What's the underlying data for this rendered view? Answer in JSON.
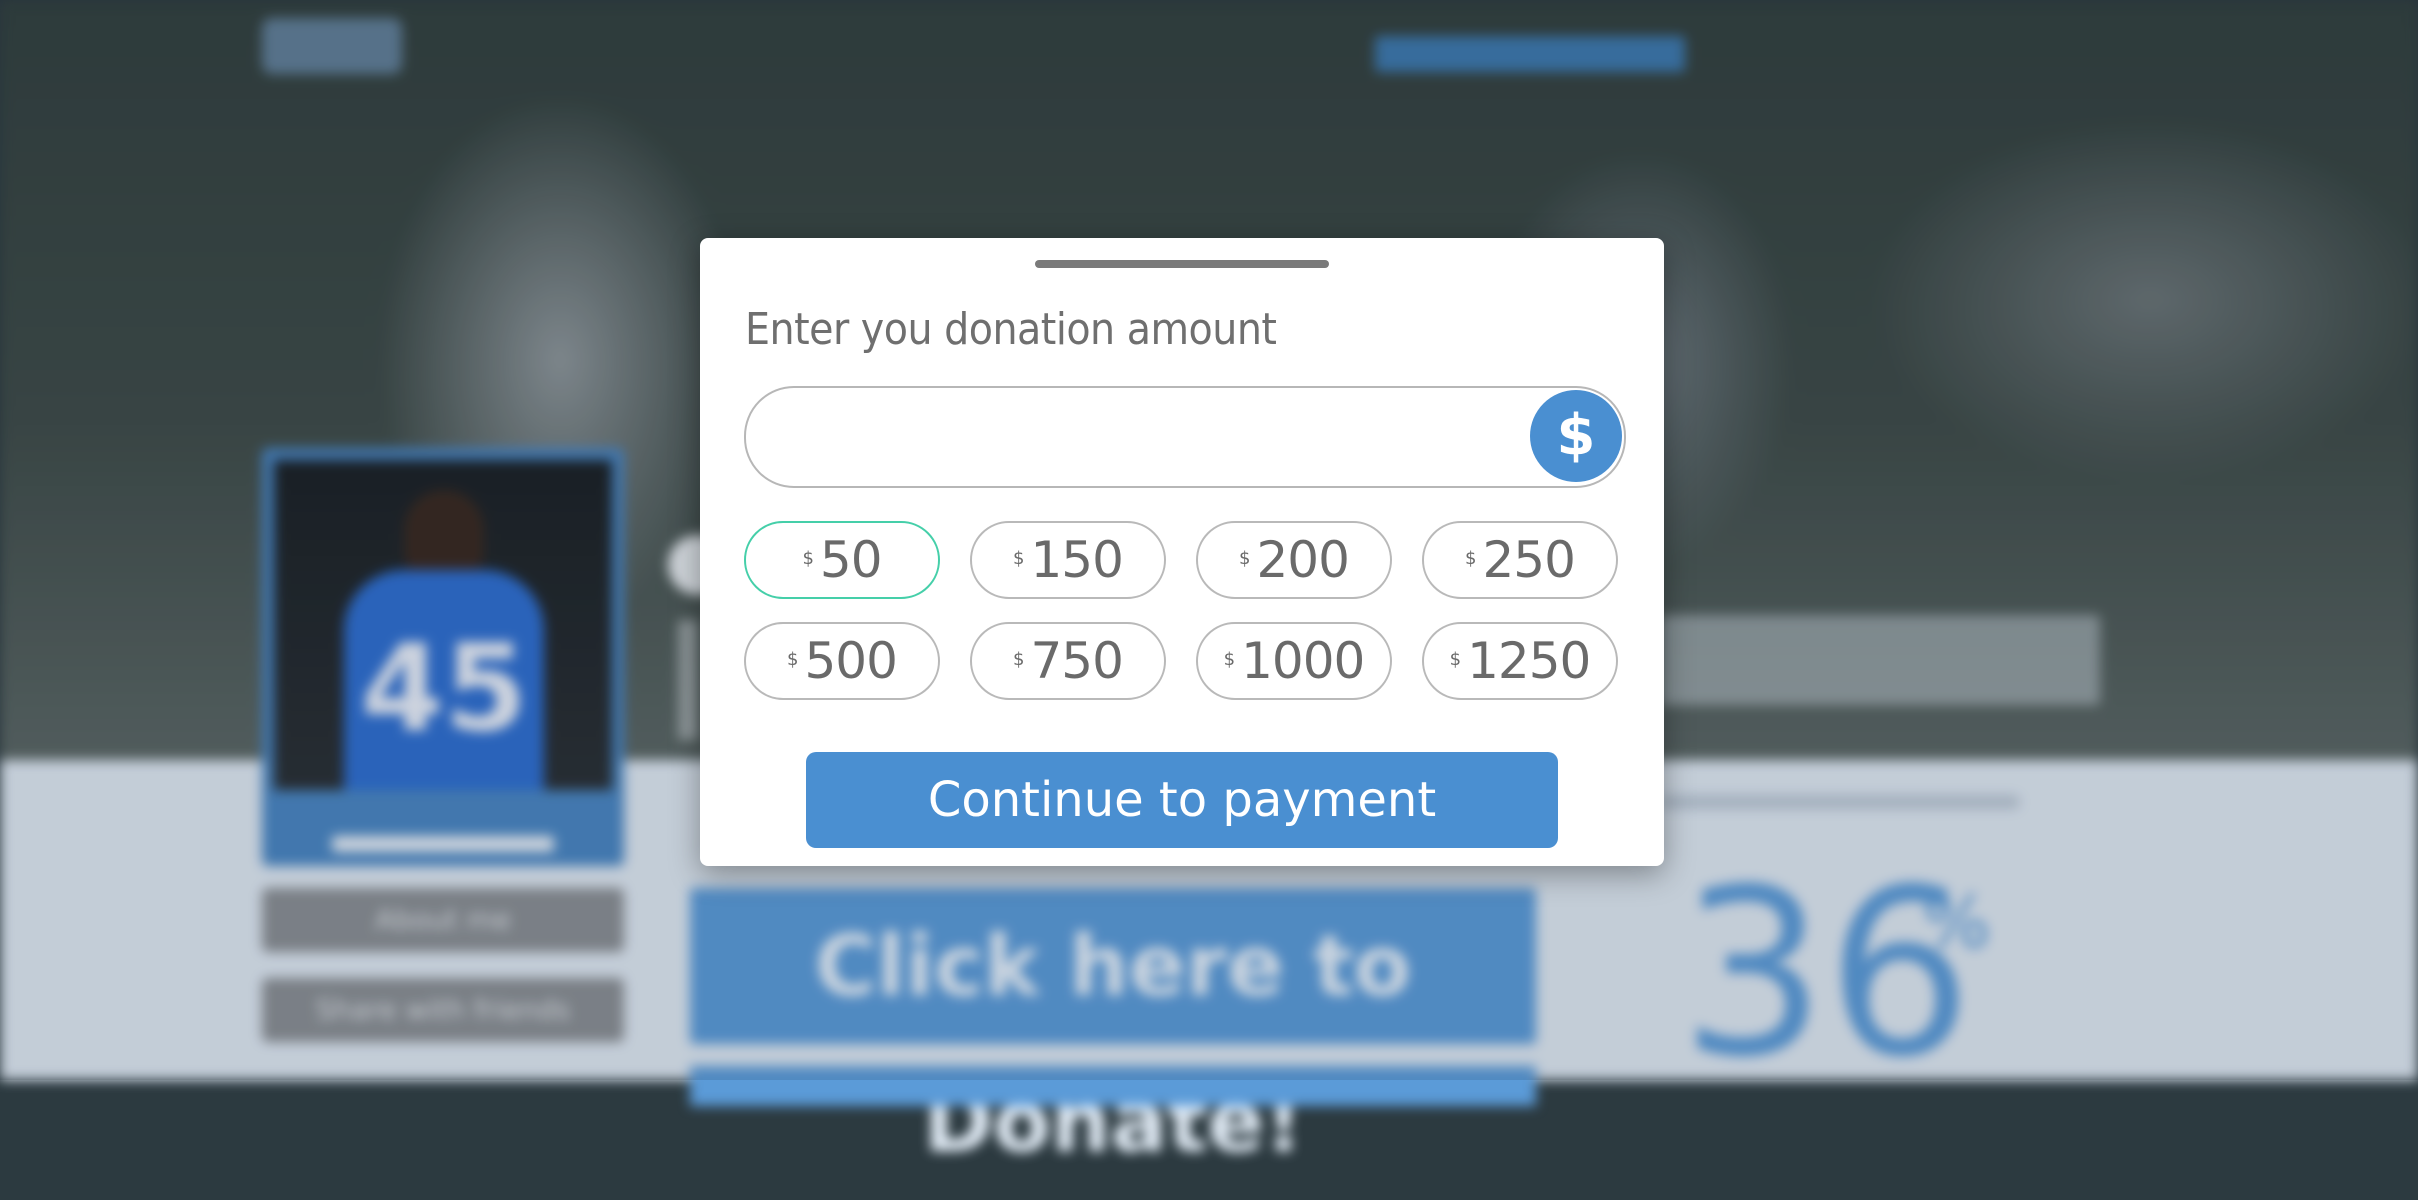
{
  "background": {
    "profile_number": "45",
    "side_buttons": [
      "About me",
      "Share with friends"
    ],
    "donate_cta": "Click here to Donate!",
    "progress_percent": "36",
    "percent_sign": "%"
  },
  "modal": {
    "title": "Enter you donation amount",
    "amount_value": "",
    "currency_symbol": "$",
    "presets": [
      {
        "currency": "$",
        "amount": "50",
        "selected": true
      },
      {
        "currency": "$",
        "amount": "150",
        "selected": false
      },
      {
        "currency": "$",
        "amount": "200",
        "selected": false
      },
      {
        "currency": "$",
        "amount": "250",
        "selected": false
      },
      {
        "currency": "$",
        "amount": "500",
        "selected": false
      },
      {
        "currency": "$",
        "amount": "750",
        "selected": false
      },
      {
        "currency": "$",
        "amount": "1000",
        "selected": false
      },
      {
        "currency": "$",
        "amount": "1250",
        "selected": false
      }
    ],
    "continue_label": "Continue to payment"
  },
  "colors": {
    "accent": "#4a8fd1",
    "selected_border": "#45cfa9"
  }
}
